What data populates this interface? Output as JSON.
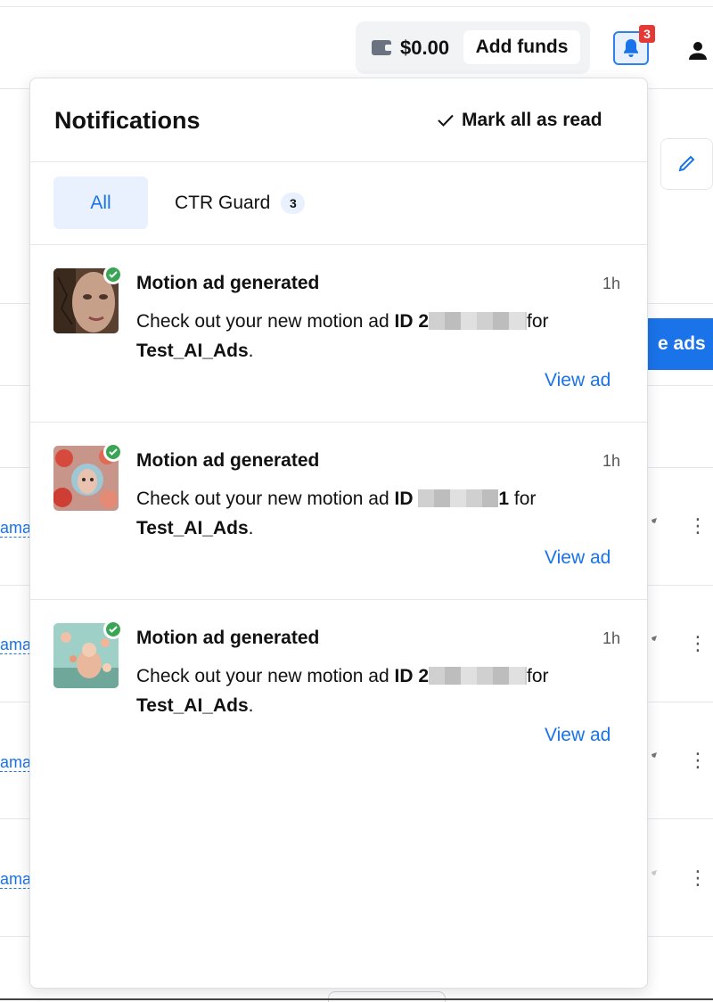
{
  "header": {
    "balance": "$0.00",
    "add_funds_label": "Add funds",
    "notification_count": "3"
  },
  "background": {
    "cta_label": "e ads",
    "row_link": "ama"
  },
  "panel": {
    "title": "Notifications",
    "mark_all_label": "Mark all as read",
    "tabs": [
      {
        "label": "All",
        "active": true
      },
      {
        "label": "CTR Guard",
        "count": "3"
      }
    ],
    "notifications": [
      {
        "title": "Motion ad generated",
        "time": "1h",
        "body_prefix": "Check out your new motion ad ",
        "id_label": "ID 2",
        "id_suffix": "",
        "for_text": "for",
        "campaign": "Test_AI_Ads",
        "period": ".",
        "link": "View ad"
      },
      {
        "title": "Motion ad generated",
        "time": "1h",
        "body_prefix": "Check out your new motion ad ",
        "id_label": "ID ",
        "id_suffix": "1",
        "for_text": " for",
        "campaign": "Test_AI_Ads",
        "period": ".",
        "link": "View ad"
      },
      {
        "title": "Motion ad generated",
        "time": "1h",
        "body_prefix": "Check out your new motion ad ",
        "id_label": "ID 2",
        "id_suffix": "",
        "for_text": "for",
        "campaign": "Test_AI_Ads",
        "period": ".",
        "link": "View ad"
      }
    ]
  },
  "colors": {
    "accent": "#1a73e8",
    "badge": "#e53935",
    "success": "#3aa655"
  }
}
